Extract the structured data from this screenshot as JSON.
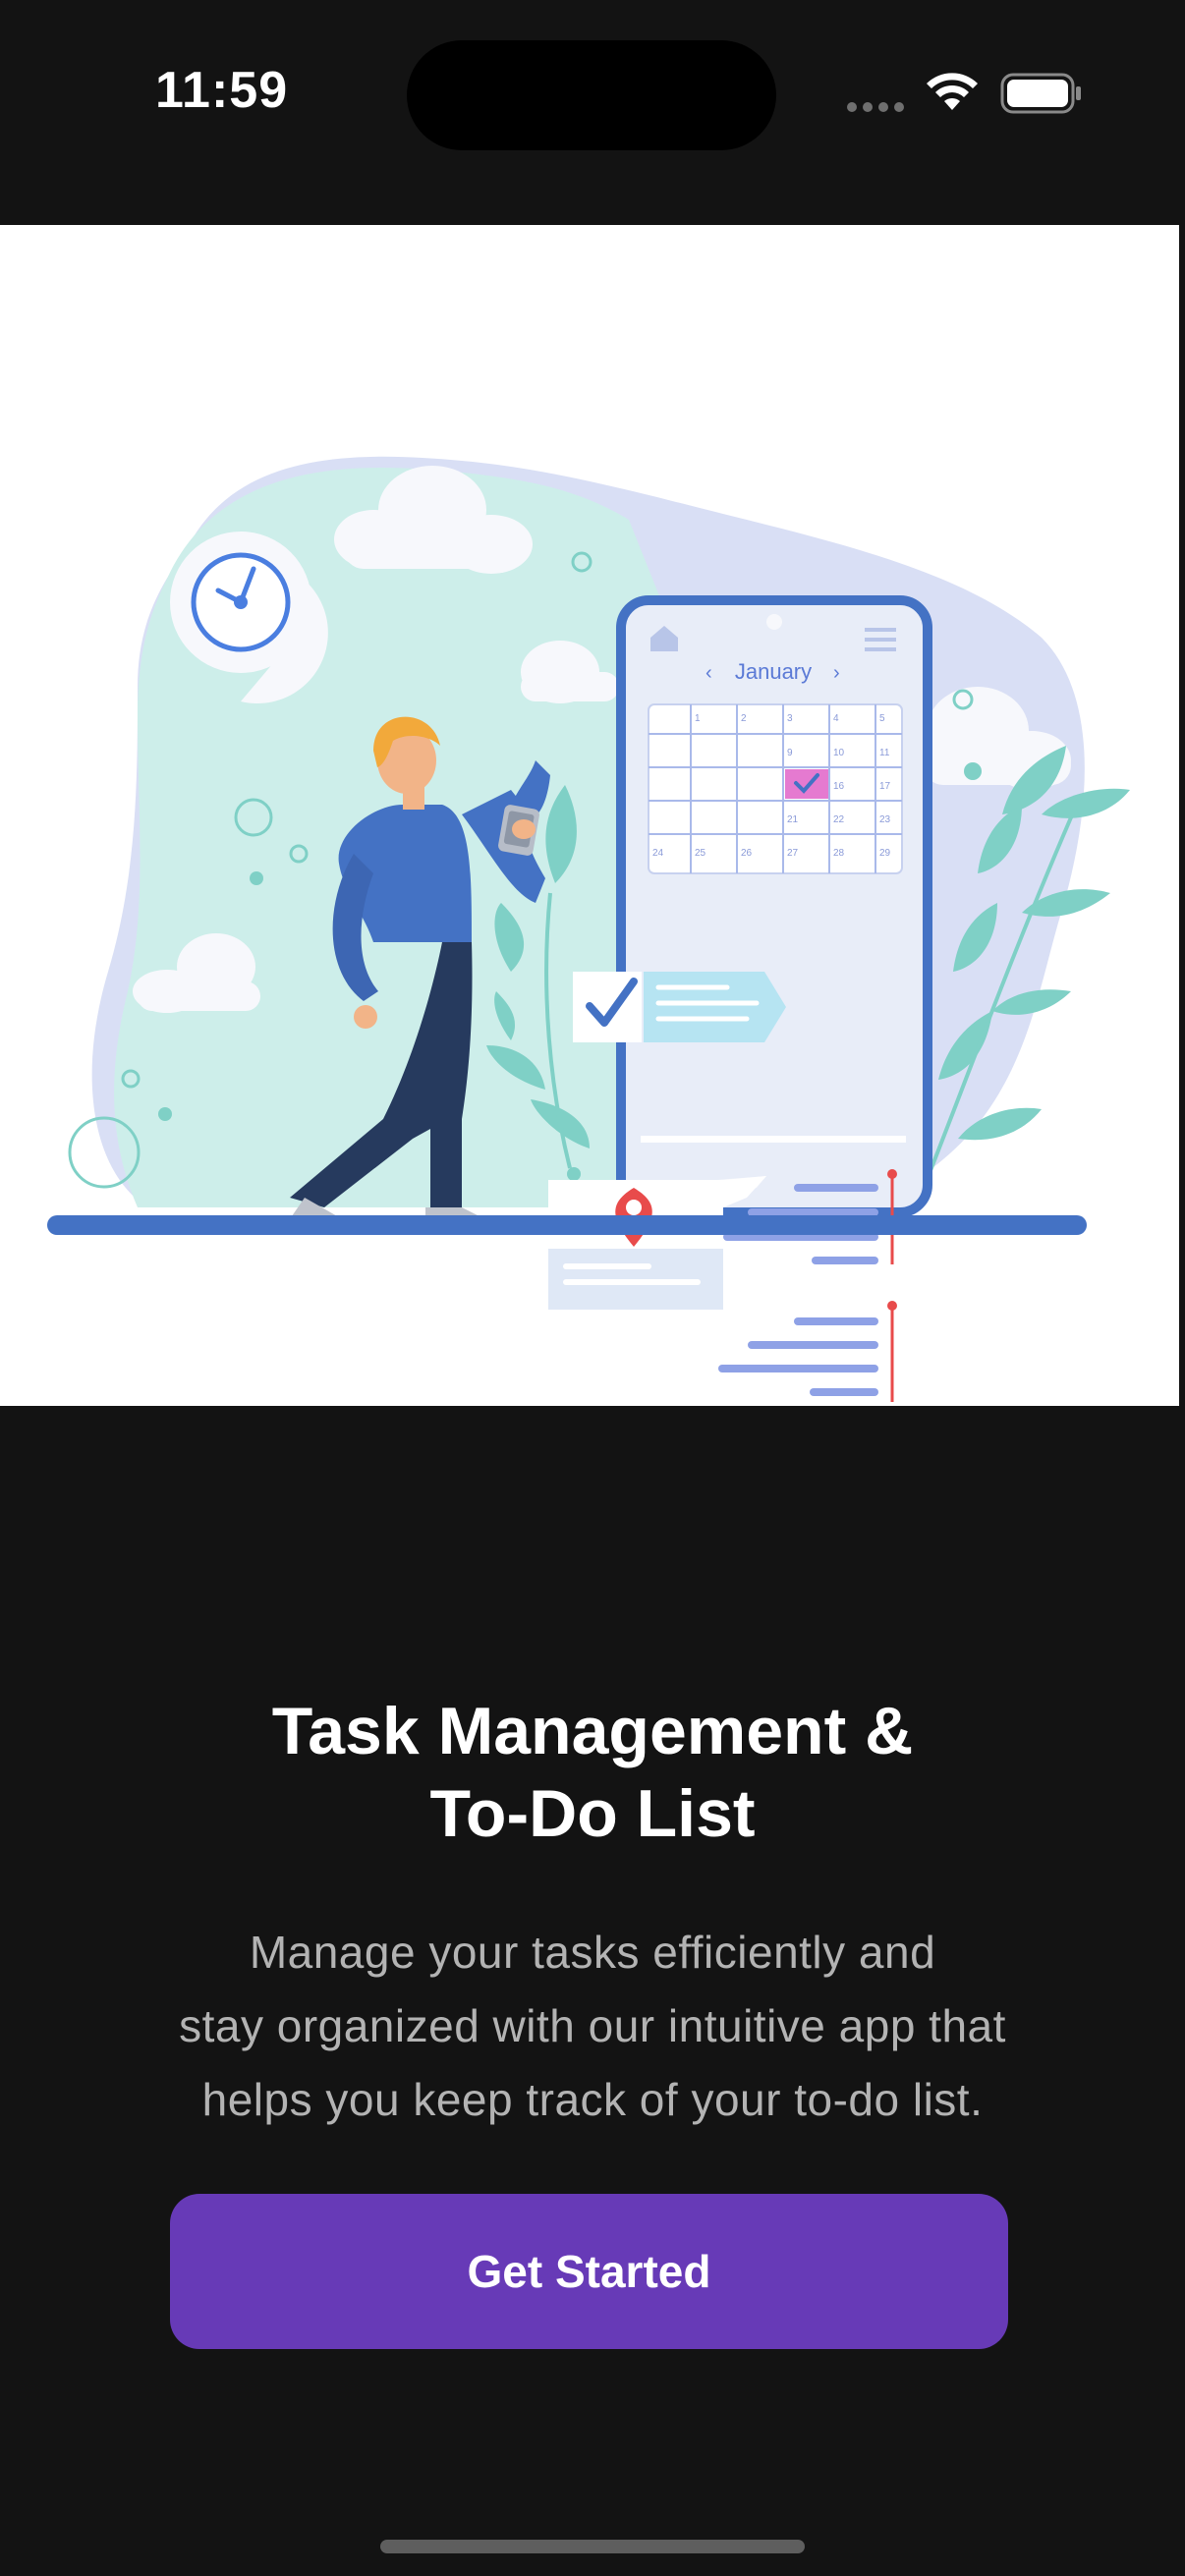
{
  "status_bar": {
    "time": "11:59",
    "icons": [
      "cellular-signal-icon",
      "wifi-icon",
      "battery-icon"
    ]
  },
  "illustration": {
    "description_icon": "task-management-illustration",
    "calendar_month": "January",
    "calendar_days": [
      "1",
      "2",
      "3",
      "4",
      "5",
      "9",
      "10",
      "11",
      "16",
      "17",
      "21",
      "22",
      "23",
      "24",
      "25",
      "26",
      "27",
      "28",
      "29"
    ]
  },
  "onboarding": {
    "title_line1": "Task Management &",
    "title_line2": "To-Do List",
    "desc_line1": "Manage your tasks efficiently and",
    "desc_line2": "stay organized with our intuitive app that",
    "desc_line3": "helps you keep track of your to-do list.",
    "cta_label": "Get Started"
  },
  "colors": {
    "background": "#131313",
    "accent": "#673ab7",
    "illustration_blue": "#4472c4",
    "illustration_mint": "#cdeeea"
  }
}
